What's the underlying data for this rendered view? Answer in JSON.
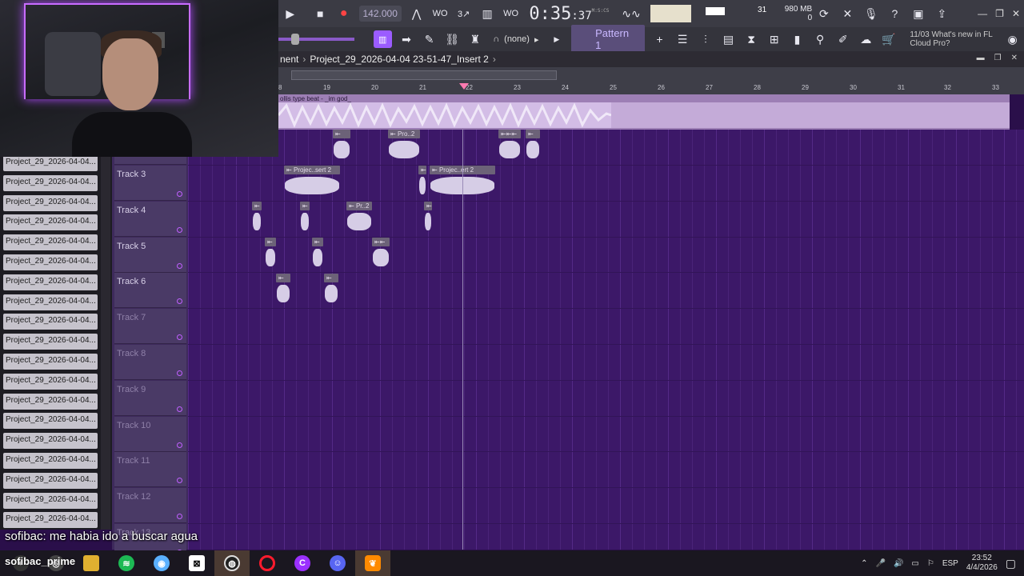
{
  "toolbar": {
    "tempo": "142.000",
    "time_main": "0:35",
    "time_sub": ":37",
    "time_unit": "M:S:CS",
    "cpu_value": "31",
    "memory": "980 MB",
    "memory_sub": "0",
    "snap_value": "(none)",
    "pattern": "Pattern 1",
    "news_line1": "11/03  What's new in FL",
    "news_line2": "Cloud Pro?"
  },
  "playlist": {
    "breadcrumb_root": "nent",
    "breadcrumb_sep": "›",
    "breadcrumb_item": "Project_29_2026-04-04 23-51-47_Insert 2",
    "breadcrumb_end": "›",
    "ruler_marks": [
      "8",
      "19",
      "20",
      "21",
      "22",
      "23",
      "24",
      "25",
      "26",
      "27",
      "28",
      "29",
      "30",
      "31",
      "32",
      "33"
    ],
    "audio_label": "ollis type beat - _im god_"
  },
  "browser": {
    "items": [
      "Project_29_2026-04-04...",
      "Project_29_2026-04-04...",
      "Project_29_2026-04-04...",
      "Project_29_2026-04-04...",
      "Project_29_2026-04-04...",
      "Project_29_2026-04-04...",
      "Project_29_2026-04-04...",
      "Project_29_2026-04-04...",
      "Project_29_2026-04-04...",
      "Project_29_2026-04-04...",
      "Project_29_2026-04-04...",
      "Project_29_2026-04-04...",
      "Project_29_2026-04-04...",
      "Project_29_2026-04-04...",
      "Project_29_2026-04-04...",
      "Project_29_2026-04-04...",
      "Project_29_2026-04-04...",
      "Project_29_2026-04-04...",
      "Project_29_2026-04-04..."
    ]
  },
  "tracks": [
    "Track 3",
    "Track 4",
    "Track 5",
    "Track 6",
    "Track 7",
    "Track 8",
    "Track 9",
    "Track 10",
    "Track 11",
    "Track 12",
    "Track 13"
  ],
  "clips": {
    "pro2": "Pro..2",
    "projec_sert2": "Projec..sert 2",
    "projec_ert2": "Projec..ert 2",
    "pr2": "Pr..2"
  },
  "chat": {
    "user": "sofibac",
    "message": "me habia ido a buscar agua"
  },
  "taskbar": {
    "user_tag": "sofibac_prime",
    "lang": "ESP",
    "time": "23:52",
    "date": "4/4/2026"
  }
}
